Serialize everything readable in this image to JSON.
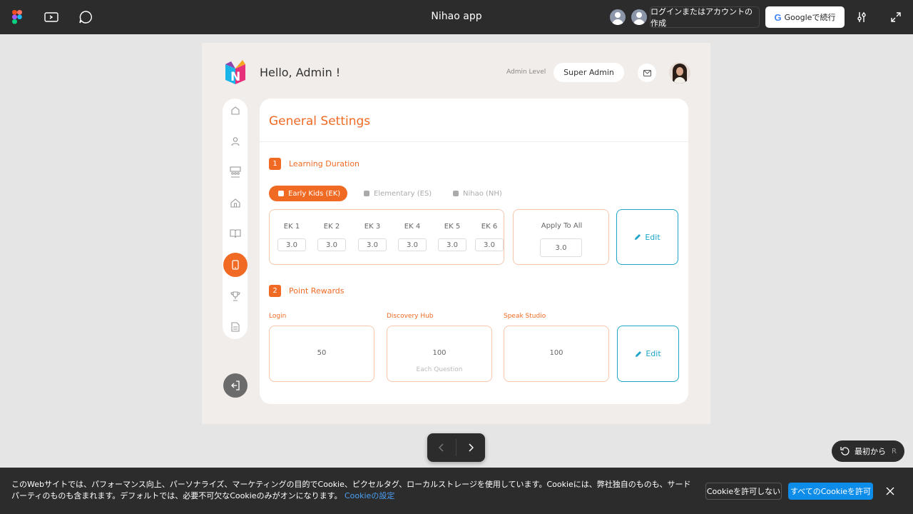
{
  "topbar": {
    "title": "Nihao app",
    "login_label": "ログインまたはアカウントの作成",
    "google_label": "Googleで続行",
    "google_logo": "G"
  },
  "header": {
    "greeting": "Hello, Admin !",
    "admin_level_label": "Admin Level",
    "admin_level_value": "Super Admin"
  },
  "sidebar": {
    "items": [
      {
        "icon": "home-icon"
      },
      {
        "icon": "user-icon"
      },
      {
        "icon": "classroom-icon"
      },
      {
        "icon": "school-icon"
      },
      {
        "icon": "book-icon"
      },
      {
        "icon": "mobile-icon",
        "active": true
      },
      {
        "icon": "trophy-icon"
      },
      {
        "icon": "document-icon"
      }
    ],
    "logout_icon": "logout-icon"
  },
  "settings": {
    "title": "General Settings",
    "learning": {
      "number": "1",
      "title": "Learning Duration",
      "tabs": [
        {
          "label": "Early Kids (EK)",
          "active": true
        },
        {
          "label": "Elementary (ES)",
          "active": false
        },
        {
          "label": "Nihao (NH)",
          "active": false
        }
      ],
      "levels": [
        {
          "label": "EK 1",
          "value": "3.0"
        },
        {
          "label": "EK 2",
          "value": "3.0"
        },
        {
          "label": "EK 3",
          "value": "3.0"
        },
        {
          "label": "EK 4",
          "value": "3.0"
        },
        {
          "label": "EK 5",
          "value": "3.0"
        },
        {
          "label": "EK 6",
          "value": "3.0"
        }
      ],
      "apply_all_label": "Apply To All",
      "apply_all_value": "3.0",
      "edit_label": "Edit"
    },
    "rewards": {
      "number": "2",
      "title": "Point Rewards",
      "items": [
        {
          "label": "Login",
          "value": "50",
          "sub": ""
        },
        {
          "label": "Discovery Hub",
          "value": "100",
          "sub": "Each Question"
        },
        {
          "label": "Speak Studio",
          "value": "100",
          "sub": ""
        }
      ],
      "edit_label": "Edit"
    }
  },
  "presentation": {
    "restart_label": "最初から",
    "restart_key": "R"
  },
  "cookie": {
    "text": "このWebサイトでは、パフォーマンス向上、パーソナライズ、マーケティングの目的でCookie、ピクセルタグ、ローカルストレージを使用しています。Cookieには、弊社独自のものも、サードパーティのものも含まれます。デフォルトでは、必要不可欠なCookieのみがオンになります。",
    "link": "Cookieの設定",
    "deny_label": "Cookieを許可しない",
    "allow_label": "すべてのCookieを許可"
  },
  "colors": {
    "accent": "#f06a24",
    "edit_blue": "#1ca5c8",
    "topbar": "#2c2c2c"
  }
}
